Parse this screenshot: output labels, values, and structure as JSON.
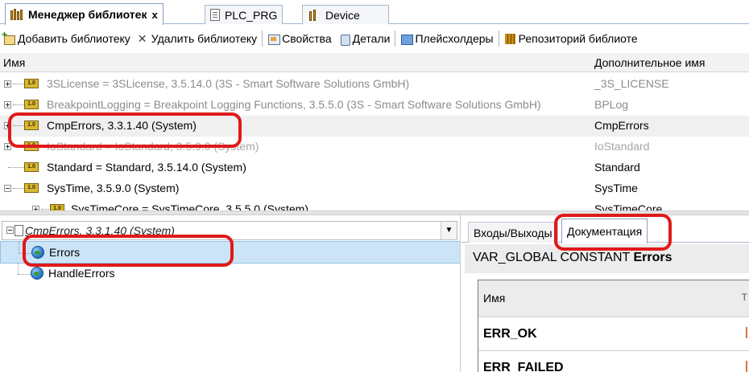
{
  "tabs": [
    {
      "label": "Менеджер библиотек",
      "close": "x",
      "active": true
    },
    {
      "label": "PLC_PRG",
      "active": false
    },
    {
      "label": "Device",
      "active": false
    }
  ],
  "toolbar": {
    "add_library": "Добавить библиотеку",
    "remove_library": "Удалить библиотеку",
    "properties": "Свойства",
    "details": "Детали",
    "placeholders": "Плейсхолдеры",
    "repository": "Репозиторий библиоте"
  },
  "library_list": {
    "col_name": "Имя",
    "col_alias": "Дополнительное имя",
    "version_icon_text": "1.0",
    "rows": [
      {
        "name": "3SLicense = 3SLicense, 3.5.14.0 (3S - Smart Software Solutions GmbH)",
        "alias": "_3S_LICENSE",
        "expander": "plus"
      },
      {
        "name": "BreakpointLogging = Breakpoint Logging Functions, 3.5.5.0 (3S - Smart Software Solutions GmbH)",
        "alias": "BPLog",
        "expander": "plus"
      },
      {
        "name": "CmpErrors, 3.3.1.40 (System)",
        "alias": "CmpErrors",
        "expander": "plus"
      },
      {
        "name": "IoStandard = IoStandard, 3.5.9.0 (System)",
        "alias": "IoStandard",
        "expander": "plus"
      },
      {
        "name": "Standard = Standard, 3.5.14.0 (System)",
        "alias": "Standard",
        "expander": "none"
      },
      {
        "name": "SysTime, 3.5.9.0 (System)",
        "alias": "SysTime",
        "expander": "minus"
      },
      {
        "name": "SysTimeCore = SysTimeCore, 3.5.5.0 (System)",
        "alias": "SysTimeCore",
        "expander": "plus"
      }
    ]
  },
  "library_tree": {
    "combo_value": "CmpErrors, 3.3.1.40 (System)",
    "items": [
      {
        "label": "Errors",
        "selected": true
      },
      {
        "label": "HandleErrors",
        "selected": false
      }
    ]
  },
  "doc_tabs": [
    {
      "label": "Входы/Выходы",
      "active": false
    },
    {
      "label": "Документация",
      "active": true
    }
  ],
  "documentation": {
    "title_prefix": "VAR_GLOBAL CONSTANT",
    "title_name": "Errors",
    "col_name": "Имя",
    "col_extra": "T",
    "rows": [
      "ERR_OK",
      "ERR_FAILED"
    ]
  },
  "colors": {
    "annotation": "#e01a1a",
    "selection": "#cce4f7",
    "tab_border": "#8aa0ba"
  }
}
